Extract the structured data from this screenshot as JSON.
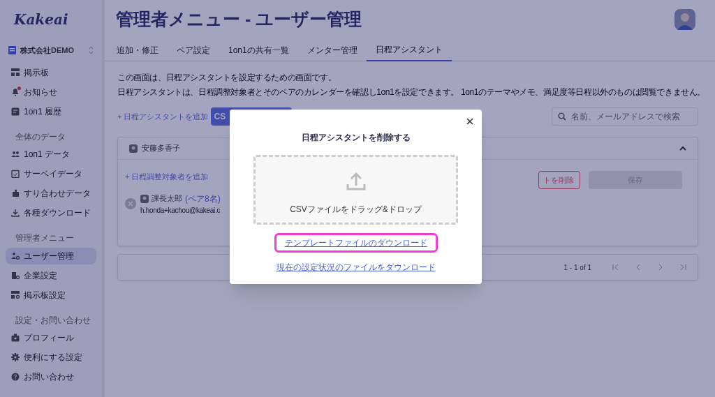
{
  "logo": "Kakeai",
  "company": {
    "name": "株式会社DEMO"
  },
  "sidebar": {
    "sections": [
      {
        "items": [
          {
            "label": "掲示板",
            "selected": false
          },
          {
            "label": "お知らせ",
            "selected": false,
            "unread": true
          },
          {
            "label": "1on1 履歴",
            "selected": false
          }
        ]
      },
      {
        "heading": "全体のデータ",
        "items": [
          {
            "label": "1on1 データ",
            "selected": false
          },
          {
            "label": "サーベイデータ",
            "selected": false
          },
          {
            "label": "すり合わせデータ",
            "selected": false
          },
          {
            "label": "各種ダウンロード",
            "selected": false
          }
        ]
      },
      {
        "heading": "管理者メニュー",
        "items": [
          {
            "label": "ユーザー管理",
            "selected": true
          },
          {
            "label": "企業設定",
            "selected": false
          },
          {
            "label": "掲示板設定",
            "selected": false
          }
        ]
      },
      {
        "heading": "設定・お問い合わせ",
        "items": [
          {
            "label": "プロフィール",
            "selected": false
          },
          {
            "label": "便利にする設定",
            "selected": false
          },
          {
            "label": "お問い合わせ",
            "selected": false
          }
        ]
      }
    ]
  },
  "page": {
    "title": "管理者メニュー - ユーザー管理",
    "tabs": [
      {
        "label": "追加・修正",
        "selected": false
      },
      {
        "label": "ペア設定",
        "selected": false
      },
      {
        "label": "1on1の共有一覧",
        "selected": false
      },
      {
        "label": "メンター管理",
        "selected": false
      },
      {
        "label": "日程アシスタント",
        "selected": true
      }
    ],
    "description": [
      "この画面は、日程アシスタントを設定するための画面です。",
      "日程アシスタントは、日程調整対象者とそのペアのカレンダーを確認し1on1を設定できます。 1on1のテーマやメモ、満足度等日程以外のものは閲覧できません。"
    ],
    "add_link": "+ 日程アシスタントを追加",
    "csv_button": "CS",
    "search": {
      "placeholder": "名前、メールアドレスで検索"
    },
    "card": {
      "owner": "安藤多香子",
      "expanded": true,
      "add_target": "+ 日程調整対象者を追加",
      "targets": [
        {
          "name": "課長太郎",
          "pairs": "(ペア8名)",
          "email": "h.honda+kachou@kakeai.c"
        }
      ],
      "delete_button": "トを削除",
      "save_button": {
        "label": "保存",
        "disabled": true
      }
    },
    "pagination": {
      "range": "1 - 1 of 1"
    }
  },
  "modal": {
    "title": "日程アシスタントを削除する",
    "dropzone": "CSVファイルをドラッグ&ドロップ",
    "links": [
      {
        "label": "テンプレートファイルのダウンロード",
        "highlighted": true
      },
      {
        "label": "現在の設定状況のファイルをダウンロード",
        "highlighted": false
      }
    ]
  }
}
